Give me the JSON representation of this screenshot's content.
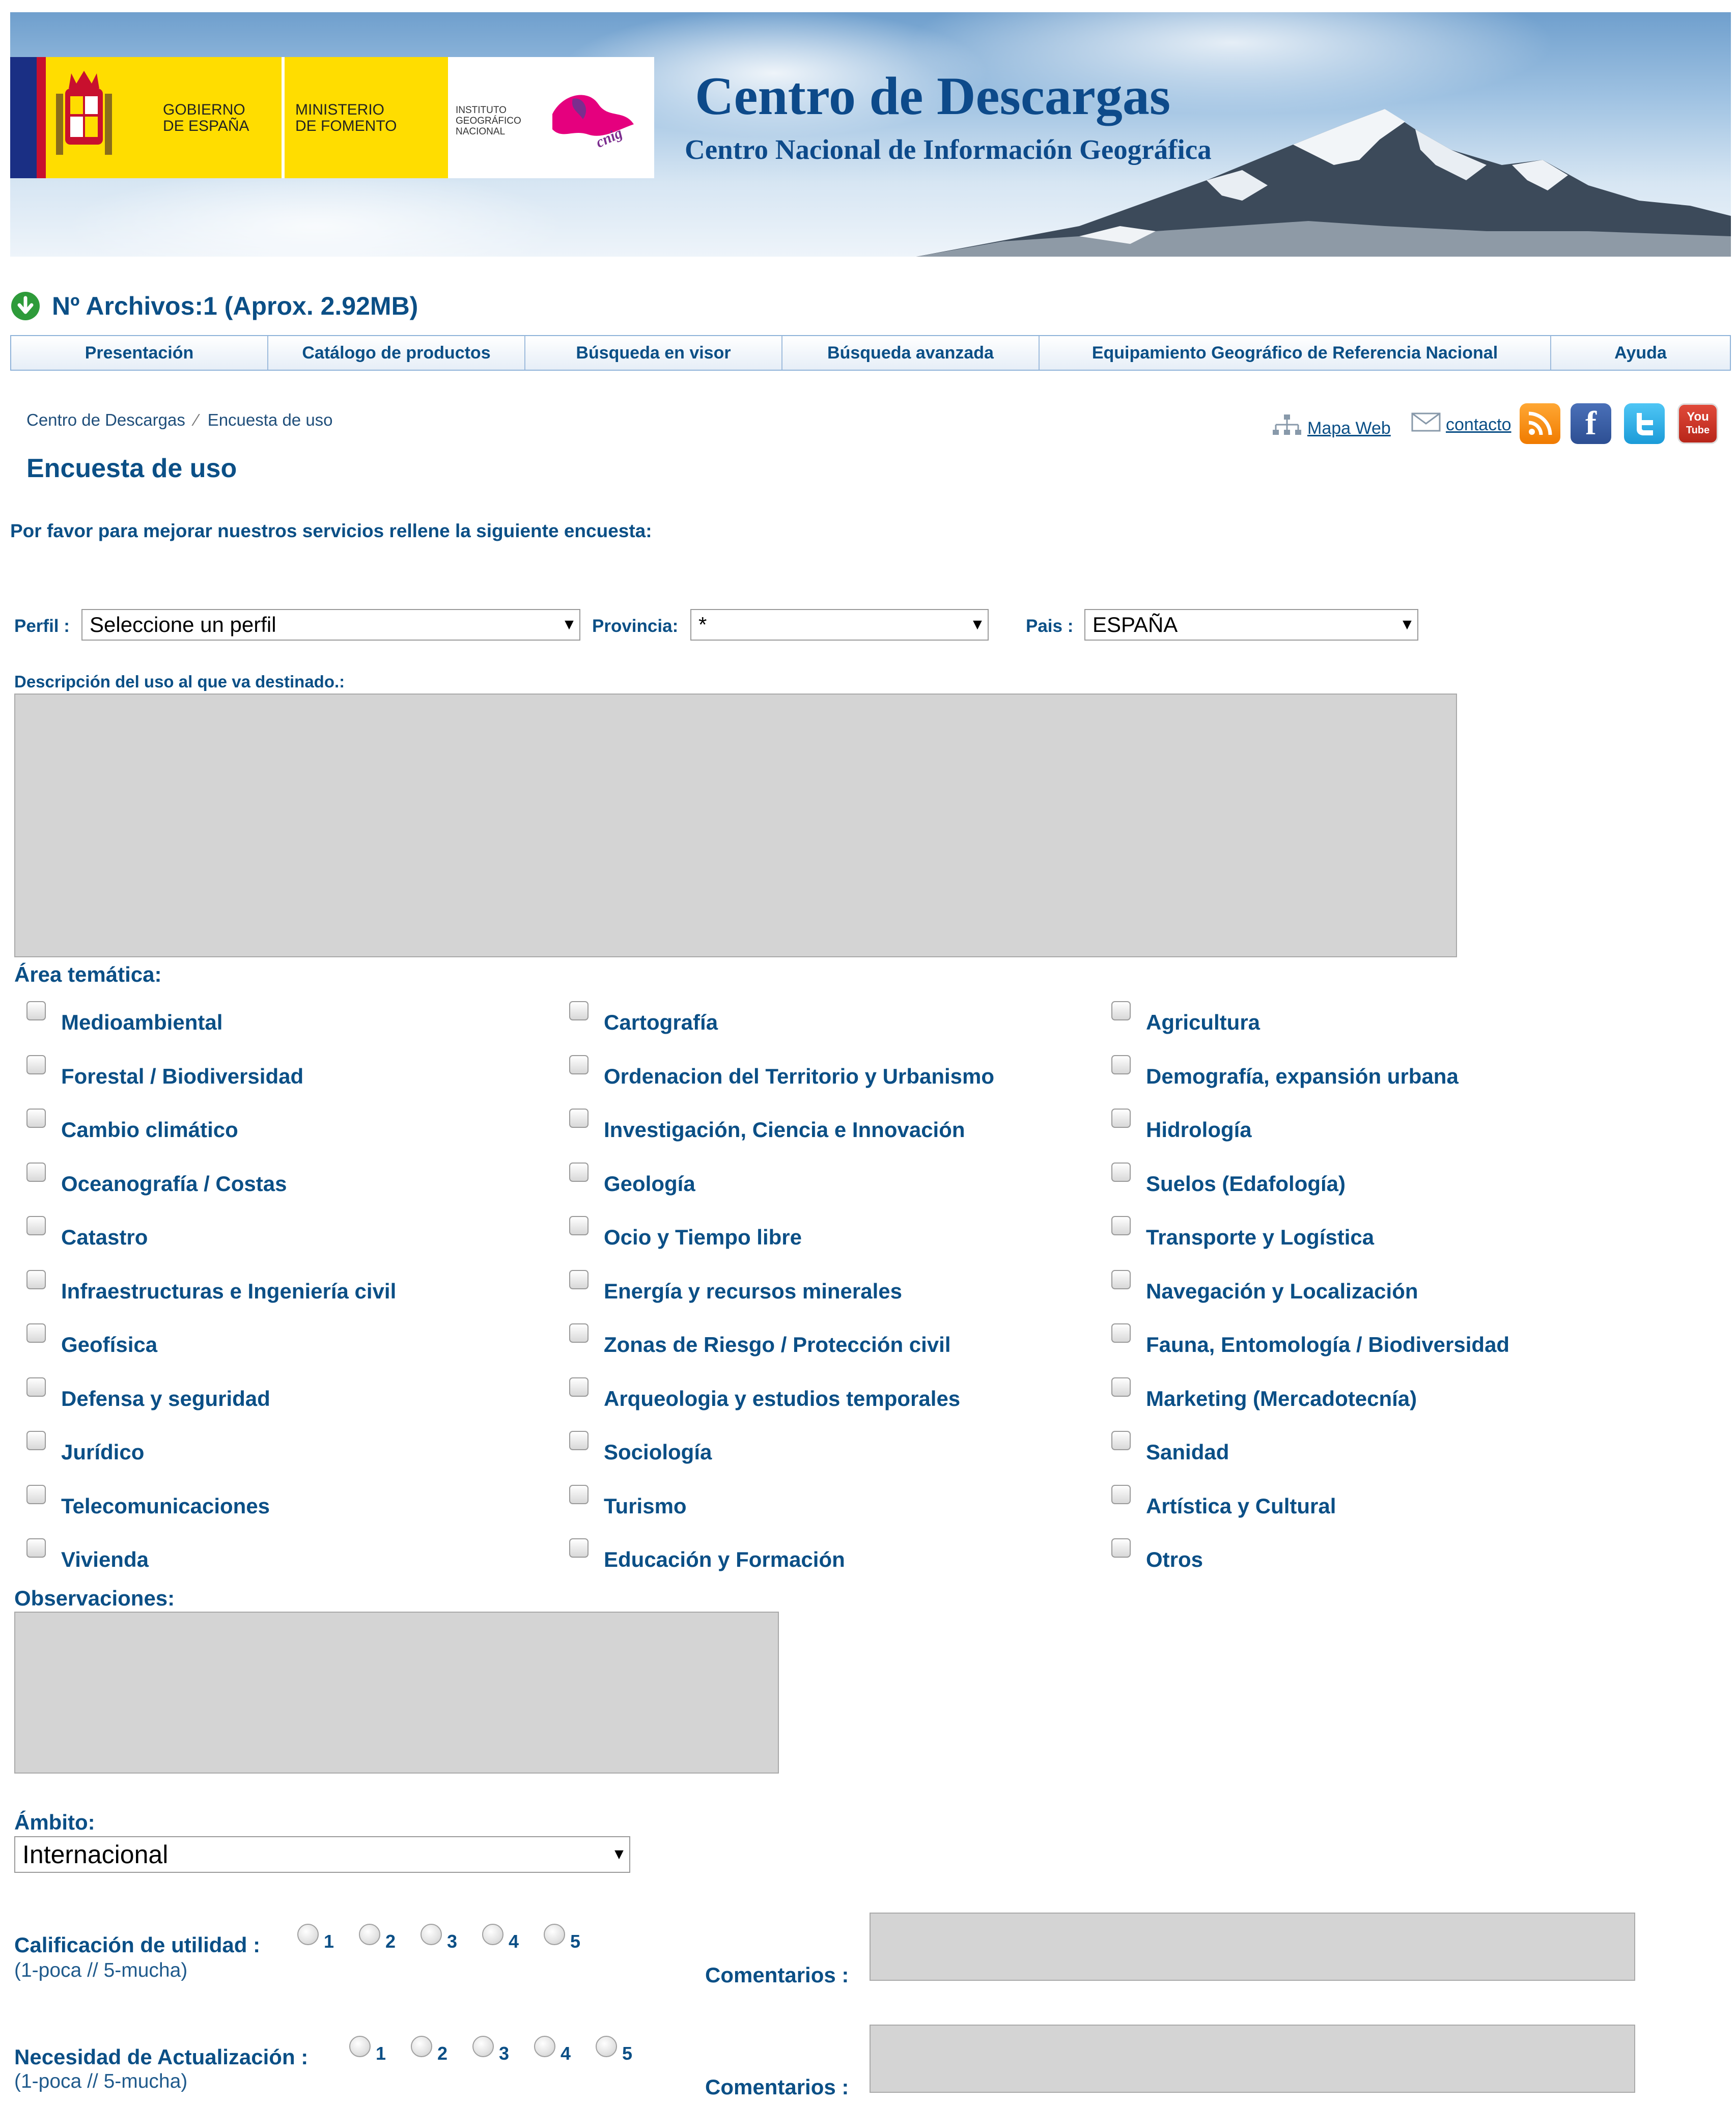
{
  "banner": {
    "gov_line1": "GOBIERNO",
    "gov_line2": "DE ESPAÑA",
    "ministry_line1": "MINISTERIO",
    "ministry_line2": "DE FOMENTO",
    "ign_line1": "INSTITUTO",
    "ign_line2": "GEOGRÁFICO",
    "ign_line3": "NACIONAL",
    "cnig_logo_text": "cnig",
    "title": "Centro de Descargas",
    "subtitle": "Centro Nacional de Información Geográfica"
  },
  "files": {
    "text": "Nº Archivos:1 (Aprox. 2.92MB)"
  },
  "nav": {
    "items": [
      "Presentación",
      "Catálogo de productos",
      "Búsqueda en visor",
      "Búsqueda avanzada",
      "Equipamiento Geográfico de Referencia Nacional",
      "Ayuda"
    ]
  },
  "breadcrumb": {
    "root": "Centro de Descargas",
    "sep": "⁄",
    "current": "Encuesta de uso"
  },
  "toplinks": {
    "mapa_web": "Mapa Web",
    "contacto": "contacto"
  },
  "social": {
    "facebook": "f",
    "youtube_line1": "You",
    "youtube_line2": "Tube"
  },
  "page_title": "Encuesta de uso",
  "intro": "Por favor para mejorar nuestros servicios rellene la siguiente encuesta:",
  "form": {
    "perfil_label": "Perfil :",
    "perfil_value": "Seleccione un perfil",
    "provincia_label": "Provincia:",
    "provincia_value": "*",
    "pais_label": "Pais :",
    "pais_value": "ESPAÑA",
    "descripcion_label": "Descripción del uso al que va destinado.:",
    "area_label": "Área temática:",
    "areas": [
      [
        "Medioambiental",
        "Cartografía",
        "Agricultura"
      ],
      [
        "Forestal / Biodiversidad",
        "Ordenacion del Territorio y Urbanismo",
        "Demografía, expansión urbana"
      ],
      [
        "Cambio climático",
        "Investigación, Ciencia e Innovación",
        "Hidrología"
      ],
      [
        "Oceanografía / Costas",
        "Geología",
        "Suelos (Edafología)"
      ],
      [
        "Catastro",
        "Ocio y Tiempo libre",
        "Transporte y Logística"
      ],
      [
        "Infraestructuras e Ingeniería civil",
        "Energía y recursos minerales",
        "Navegación y Localización"
      ],
      [
        "Geofísica",
        "Zonas de Riesgo / Protección civil",
        "Fauna, Entomología / Biodiversidad"
      ],
      [
        "Defensa y seguridad",
        "Arqueologia y estudios temporales",
        "Marketing (Mercadotecnía)"
      ],
      [
        "Jurídico",
        "Sociología",
        "Sanidad"
      ],
      [
        "Telecomunicaciones",
        "Turismo",
        "Artística y Cultural"
      ],
      [
        "Vivienda",
        "Educación y Formación",
        "Otros"
      ]
    ],
    "observaciones_label": "Observaciones:",
    "ambito_label": "Ámbito:",
    "ambito_value": "Internacional",
    "utilidad_label": "Calificación de utilidad :",
    "utilidad_note": "(1-poca // 5-mucha)",
    "actualizacion_label": "Necesidad de Actualización :",
    "actualizacion_note": "(1-poca // 5-mucha)",
    "radio_options": [
      "1",
      "2",
      "3",
      "4",
      "5"
    ],
    "comentarios_label": "Comentarios :"
  },
  "colors": {
    "brand_blue": "#0b4f86",
    "gov_yellow": "#ffdd00",
    "field_gray": "#d4d4d4"
  }
}
